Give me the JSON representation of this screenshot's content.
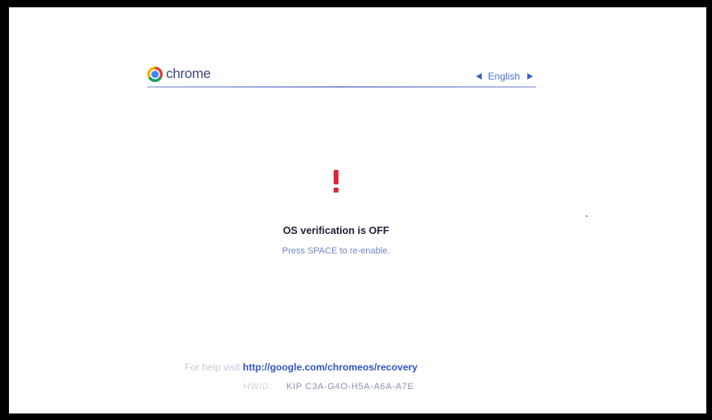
{
  "header": {
    "brand": "chrome",
    "language": "English"
  },
  "status": {
    "title": "OS verification is OFF",
    "subtitle": "Press SPACE to re-enable."
  },
  "footer": {
    "help_prefix": "For help visit",
    "help_url": "http://google.com/chromeos/recovery",
    "hwid_prefix": "HWID:",
    "hwid_value": "KIP C3A-G4O-H5A-A6A-A7E"
  },
  "colors": {
    "warning": "#e0253a",
    "link": "#2f55c8",
    "accent": "#6f86c8"
  },
  "icons": {
    "logo": "chrome-logo-icon",
    "prev_lang": "arrow-left-icon",
    "next_lang": "arrow-right-icon",
    "warning": "exclamation-icon"
  }
}
